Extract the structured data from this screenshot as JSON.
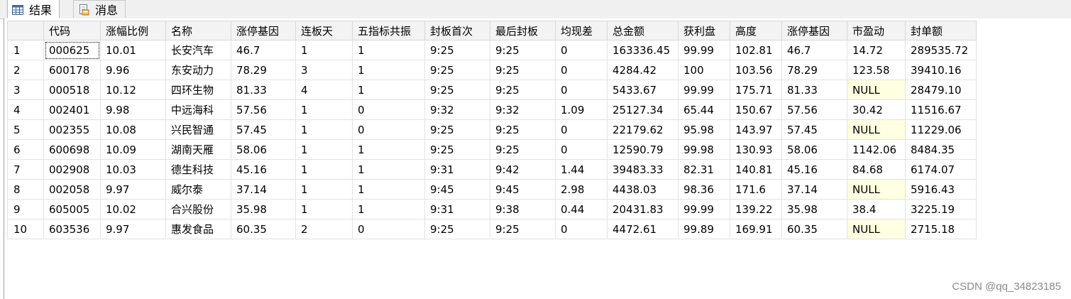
{
  "tabs": [
    {
      "label": "结果",
      "icon": "grid-results-icon"
    },
    {
      "label": "消息",
      "icon": "messages-document-icon"
    }
  ],
  "columns": [
    "",
    "代码",
    "涨幅比例",
    "名称",
    "涨停基因",
    "连板天",
    "五指标共振",
    "封板首次",
    "最后封板",
    "均现差",
    "总金额",
    "获利盘",
    "高度",
    "涨停基因",
    "市盈动",
    "封单额"
  ],
  "rows": [
    [
      "1",
      "000625",
      "10.01",
      "长安汽车",
      "46.7",
      "1",
      "1",
      "9:25",
      "9:25",
      "0",
      "163336.45",
      "99.99",
      "102.81",
      "46.7",
      "14.72",
      "289535.72"
    ],
    [
      "2",
      "600178",
      "9.96",
      "东安动力",
      "78.29",
      "3",
      "1",
      "9:25",
      "9:25",
      "0",
      "4284.42",
      "100",
      "103.56",
      "78.29",
      "123.58",
      "39410.16"
    ],
    [
      "3",
      "000518",
      "10.12",
      "四环生物",
      "81.33",
      "4",
      "1",
      "9:25",
      "9:25",
      "0",
      "5433.67",
      "99.99",
      "175.71",
      "81.33",
      "NULL",
      "28479.10"
    ],
    [
      "4",
      "002401",
      "9.98",
      "中远海科",
      "57.56",
      "1",
      "0",
      "9:32",
      "9:32",
      "1.09",
      "25127.34",
      "65.44",
      "150.67",
      "57.56",
      "30.42",
      "11516.67"
    ],
    [
      "5",
      "002355",
      "10.08",
      "兴民智通",
      "57.45",
      "1",
      "0",
      "9:25",
      "9:25",
      "0",
      "22179.62",
      "95.98",
      "143.97",
      "57.45",
      "NULL",
      "11229.06"
    ],
    [
      "6",
      "600698",
      "10.09",
      "湖南天雁",
      "58.06",
      "1",
      "1",
      "9:25",
      "9:25",
      "0",
      "12590.79",
      "99.98",
      "130.93",
      "58.06",
      "1142.06",
      "8484.35"
    ],
    [
      "7",
      "002908",
      "10.03",
      "德生科技",
      "45.16",
      "1",
      "1",
      "9:31",
      "9:42",
      "1.44",
      "39483.33",
      "82.31",
      "140.81",
      "45.16",
      "84.68",
      "6174.07"
    ],
    [
      "8",
      "002058",
      "9.97",
      "威尔泰",
      "37.14",
      "1",
      "1",
      "9:45",
      "9:45",
      "2.98",
      "4438.03",
      "98.36",
      "171.6",
      "37.14",
      "NULL",
      "5916.43"
    ],
    [
      "9",
      "605005",
      "10.02",
      "合兴股份",
      "35.98",
      "1",
      "1",
      "9:31",
      "9:38",
      "0.44",
      "20431.83",
      "99.99",
      "139.22",
      "35.98",
      "38.4",
      "3225.19"
    ],
    [
      "10",
      "603536",
      "9.97",
      "惠发食品",
      "60.35",
      "2",
      "0",
      "9:25",
      "9:25",
      "0",
      "4472.61",
      "99.89",
      "169.91",
      "60.35",
      "NULL",
      "2715.18"
    ]
  ],
  "null_text": "NULL",
  "null_cell_color": "#ffffe1",
  "watermark": "CSDN @qq_34823185"
}
